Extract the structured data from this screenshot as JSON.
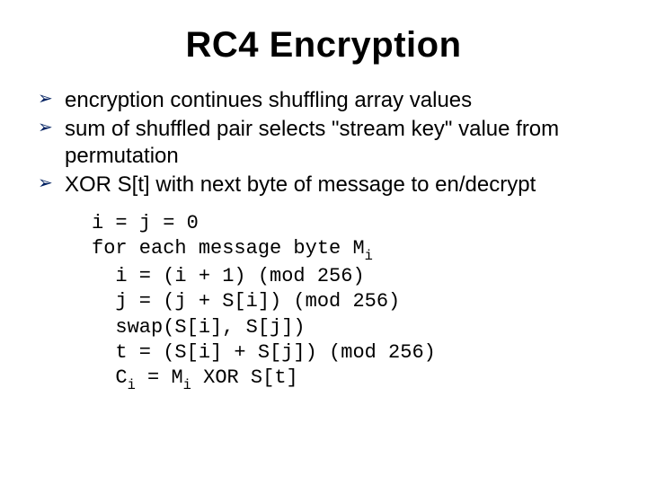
{
  "title": "RC4 Encryption",
  "bullets": [
    "encryption continues shuffling array values",
    "sum of shuffled pair selects \"stream key\" value from permutation",
    "XOR S[t] with next byte of message to en/decrypt"
  ],
  "code": {
    "l1": "i = j = 0",
    "l2_a": "for each message byte M",
    "l2_sub": "i",
    "l3": "  i = (i + 1) (mod 256)",
    "l4": "  j = (j + S[i]) (mod 256)",
    "l5": "  swap(S[i], S[j])",
    "l6": "  t = (S[i] + S[j]) (mod 256)",
    "l7_a": "  C",
    "l7_sub1": "i",
    "l7_b": " = M",
    "l7_sub2": "i",
    "l7_c": " XOR S[t]"
  },
  "bullet_glyph": "➢"
}
